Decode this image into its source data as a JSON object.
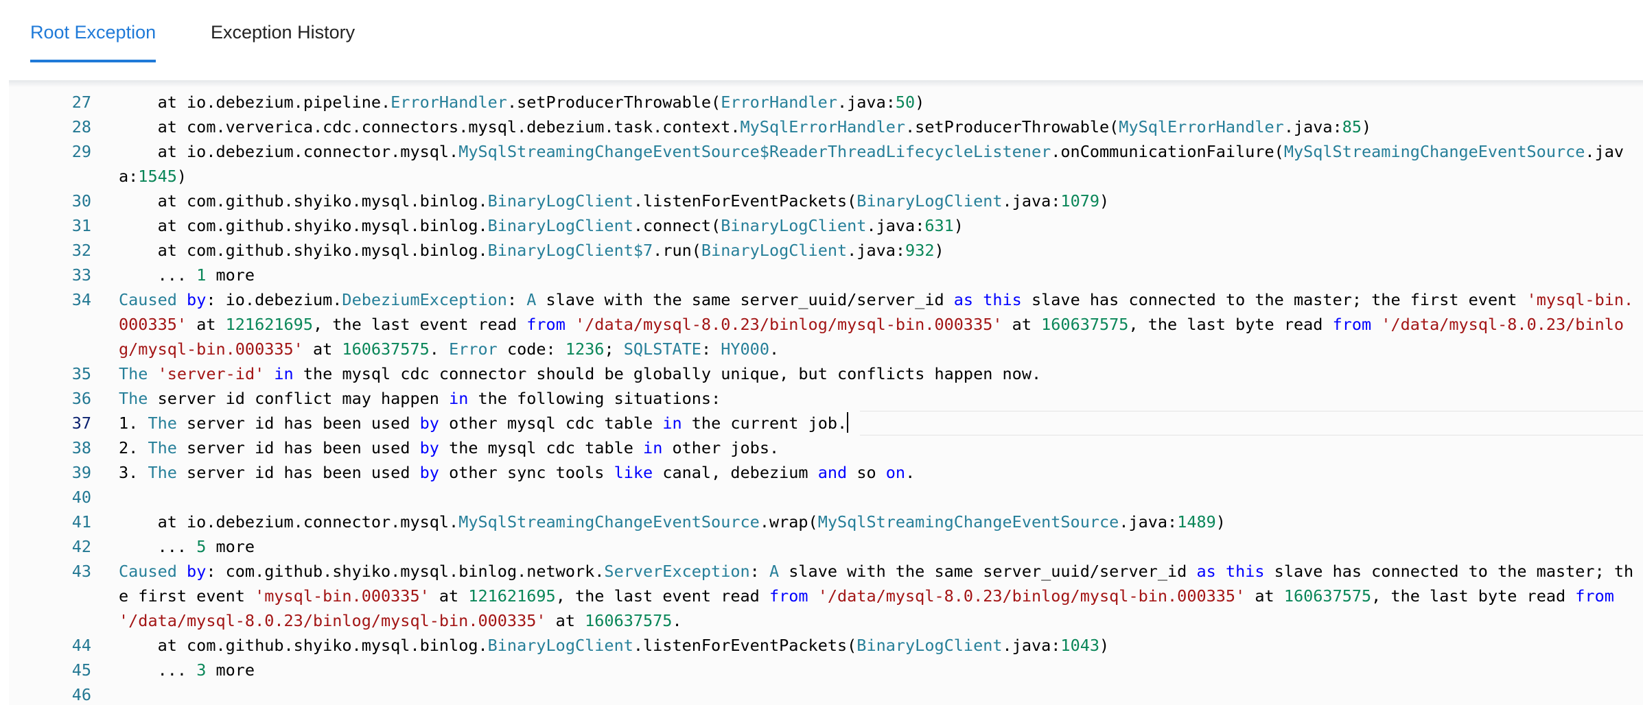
{
  "tabs": [
    {
      "label": "Root Exception",
      "active": true
    },
    {
      "label": "Exception History",
      "active": false
    }
  ],
  "editor": {
    "active_line": "37",
    "colors": {
      "default": "#000000",
      "type": "#267f99",
      "number": "#098658",
      "keyword": "#0000ff",
      "string": "#a31515",
      "line_number": "#237893",
      "active_tab": "#1f7ad8"
    },
    "lines": [
      {
        "n": "27",
        "tokens": [
          {
            "t": "    at io.debezium.pipeline.",
            "c": "default"
          },
          {
            "t": "ErrorHandler",
            "c": "type"
          },
          {
            "t": ".setProducerThrowable(",
            "c": "default"
          },
          {
            "t": "ErrorHandler",
            "c": "type"
          },
          {
            "t": ".java:",
            "c": "default"
          },
          {
            "t": "50",
            "c": "number"
          },
          {
            "t": ")",
            "c": "default"
          }
        ]
      },
      {
        "n": "28",
        "tokens": [
          {
            "t": "    at com.ververica.cdc.connectors.mysql.debezium.task.context.",
            "c": "default"
          },
          {
            "t": "MySqlErrorHandler",
            "c": "type"
          },
          {
            "t": ".setProducerThrowable(",
            "c": "default"
          },
          {
            "t": "MySqlErrorHandler",
            "c": "type"
          },
          {
            "t": ".java:",
            "c": "default"
          },
          {
            "t": "85",
            "c": "number"
          },
          {
            "t": ")",
            "c": "default"
          }
        ]
      },
      {
        "n": "29",
        "tokens": [
          {
            "t": "    at io.debezium.connector.mysql.",
            "c": "default"
          },
          {
            "t": "MySqlStreamingChangeEventSource$ReaderThreadLifecycleListener",
            "c": "type"
          },
          {
            "t": ".onCommunicationFailure(",
            "c": "default"
          },
          {
            "t": "MySqlStreamingChangeEventSource",
            "c": "type"
          },
          {
            "t": ".java:",
            "c": "default"
          },
          {
            "t": "1545",
            "c": "number"
          },
          {
            "t": ")",
            "c": "default"
          }
        ]
      },
      {
        "n": "30",
        "tokens": [
          {
            "t": "    at com.github.shyiko.mysql.binlog.",
            "c": "default"
          },
          {
            "t": "BinaryLogClient",
            "c": "type"
          },
          {
            "t": ".listenForEventPackets(",
            "c": "default"
          },
          {
            "t": "BinaryLogClient",
            "c": "type"
          },
          {
            "t": ".java:",
            "c": "default"
          },
          {
            "t": "1079",
            "c": "number"
          },
          {
            "t": ")",
            "c": "default"
          }
        ]
      },
      {
        "n": "31",
        "tokens": [
          {
            "t": "    at com.github.shyiko.mysql.binlog.",
            "c": "default"
          },
          {
            "t": "BinaryLogClient",
            "c": "type"
          },
          {
            "t": ".connect(",
            "c": "default"
          },
          {
            "t": "BinaryLogClient",
            "c": "type"
          },
          {
            "t": ".java:",
            "c": "default"
          },
          {
            "t": "631",
            "c": "number"
          },
          {
            "t": ")",
            "c": "default"
          }
        ]
      },
      {
        "n": "32",
        "tokens": [
          {
            "t": "    at com.github.shyiko.mysql.binlog.",
            "c": "default"
          },
          {
            "t": "BinaryLogClient$7",
            "c": "type"
          },
          {
            "t": ".run(",
            "c": "default"
          },
          {
            "t": "BinaryLogClient",
            "c": "type"
          },
          {
            "t": ".java:",
            "c": "default"
          },
          {
            "t": "932",
            "c": "number"
          },
          {
            "t": ")",
            "c": "default"
          }
        ]
      },
      {
        "n": "33",
        "tokens": [
          {
            "t": "    ... ",
            "c": "default"
          },
          {
            "t": "1",
            "c": "number"
          },
          {
            "t": " more",
            "c": "default"
          }
        ]
      },
      {
        "n": "34",
        "tokens": [
          {
            "t": "Caused",
            "c": "type"
          },
          {
            "t": " ",
            "c": "default"
          },
          {
            "t": "by",
            "c": "keyword"
          },
          {
            "t": ": io.debezium.",
            "c": "default"
          },
          {
            "t": "DebeziumException",
            "c": "type"
          },
          {
            "t": ": ",
            "c": "default"
          },
          {
            "t": "A",
            "c": "type"
          },
          {
            "t": " slave with the same server_uuid/server_id ",
            "c": "default"
          },
          {
            "t": "as",
            "c": "keyword"
          },
          {
            "t": " ",
            "c": "default"
          },
          {
            "t": "this",
            "c": "keyword"
          },
          {
            "t": " slave has connected to the master; the first event ",
            "c": "default"
          },
          {
            "t": "'mysql-bin.000335'",
            "c": "string"
          },
          {
            "t": " at ",
            "c": "default"
          },
          {
            "t": "121621695",
            "c": "number"
          },
          {
            "t": ", the last event read ",
            "c": "default"
          },
          {
            "t": "from",
            "c": "keyword"
          },
          {
            "t": " ",
            "c": "default"
          },
          {
            "t": "'/data/mysql-8.0.23/binlog/mysql-bin.000335'",
            "c": "string"
          },
          {
            "t": " at ",
            "c": "default"
          },
          {
            "t": "160637575",
            "c": "number"
          },
          {
            "t": ", the last byte read ",
            "c": "default"
          },
          {
            "t": "from",
            "c": "keyword"
          },
          {
            "t": " ",
            "c": "default"
          },
          {
            "t": "'/data/mysql-8.0.23/binlog/mysql-bin.000335'",
            "c": "string"
          },
          {
            "t": " at ",
            "c": "default"
          },
          {
            "t": "160637575",
            "c": "number"
          },
          {
            "t": ". ",
            "c": "default"
          },
          {
            "t": "Error",
            "c": "type"
          },
          {
            "t": " code: ",
            "c": "default"
          },
          {
            "t": "1236",
            "c": "number"
          },
          {
            "t": "; ",
            "c": "default"
          },
          {
            "t": "SQLSTATE",
            "c": "type"
          },
          {
            "t": ": ",
            "c": "default"
          },
          {
            "t": "HY000",
            "c": "type"
          },
          {
            "t": ".",
            "c": "default"
          }
        ]
      },
      {
        "n": "35",
        "tokens": [
          {
            "t": "The",
            "c": "type"
          },
          {
            "t": " ",
            "c": "default"
          },
          {
            "t": "'server-id'",
            "c": "string"
          },
          {
            "t": " ",
            "c": "default"
          },
          {
            "t": "in",
            "c": "keyword"
          },
          {
            "t": " the mysql cdc connector should be globally unique, but conflicts happen now.",
            "c": "default"
          }
        ]
      },
      {
        "n": "36",
        "tokens": [
          {
            "t": "The",
            "c": "type"
          },
          {
            "t": " server id conflict may happen ",
            "c": "default"
          },
          {
            "t": "in",
            "c": "keyword"
          },
          {
            "t": " the following situations:",
            "c": "default"
          }
        ]
      },
      {
        "n": "37",
        "cursor": true,
        "tokens": [
          {
            "t": "1. ",
            "c": "default"
          },
          {
            "t": "The",
            "c": "type"
          },
          {
            "t": " server id has been used ",
            "c": "default"
          },
          {
            "t": "by",
            "c": "keyword"
          },
          {
            "t": " other mysql cdc table ",
            "c": "default"
          },
          {
            "t": "in",
            "c": "keyword"
          },
          {
            "t": " the current job.",
            "c": "default"
          }
        ]
      },
      {
        "n": "38",
        "tokens": [
          {
            "t": "2. ",
            "c": "default"
          },
          {
            "t": "The",
            "c": "type"
          },
          {
            "t": " server id has been used ",
            "c": "default"
          },
          {
            "t": "by",
            "c": "keyword"
          },
          {
            "t": " the mysql cdc table ",
            "c": "default"
          },
          {
            "t": "in",
            "c": "keyword"
          },
          {
            "t": " other jobs.",
            "c": "default"
          }
        ]
      },
      {
        "n": "39",
        "tokens": [
          {
            "t": "3. ",
            "c": "default"
          },
          {
            "t": "The",
            "c": "type"
          },
          {
            "t": " server id has been used ",
            "c": "default"
          },
          {
            "t": "by",
            "c": "keyword"
          },
          {
            "t": " other sync tools ",
            "c": "default"
          },
          {
            "t": "like",
            "c": "keyword"
          },
          {
            "t": " canal, debezium ",
            "c": "default"
          },
          {
            "t": "and",
            "c": "keyword"
          },
          {
            "t": " so ",
            "c": "default"
          },
          {
            "t": "on",
            "c": "keyword"
          },
          {
            "t": ".",
            "c": "default"
          }
        ]
      },
      {
        "n": "40",
        "tokens": []
      },
      {
        "n": "41",
        "tokens": [
          {
            "t": "    at io.debezium.connector.mysql.",
            "c": "default"
          },
          {
            "t": "MySqlStreamingChangeEventSource",
            "c": "type"
          },
          {
            "t": ".wrap(",
            "c": "default"
          },
          {
            "t": "MySqlStreamingChangeEventSource",
            "c": "type"
          },
          {
            "t": ".java:",
            "c": "default"
          },
          {
            "t": "1489",
            "c": "number"
          },
          {
            "t": ")",
            "c": "default"
          }
        ]
      },
      {
        "n": "42",
        "tokens": [
          {
            "t": "    ... ",
            "c": "default"
          },
          {
            "t": "5",
            "c": "number"
          },
          {
            "t": " more",
            "c": "default"
          }
        ]
      },
      {
        "n": "43",
        "tokens": [
          {
            "t": "Caused",
            "c": "type"
          },
          {
            "t": " ",
            "c": "default"
          },
          {
            "t": "by",
            "c": "keyword"
          },
          {
            "t": ": com.github.shyiko.mysql.binlog.network.",
            "c": "default"
          },
          {
            "t": "ServerException",
            "c": "type"
          },
          {
            "t": ": ",
            "c": "default"
          },
          {
            "t": "A",
            "c": "type"
          },
          {
            "t": " slave with the same server_uuid/server_id ",
            "c": "default"
          },
          {
            "t": "as",
            "c": "keyword"
          },
          {
            "t": " ",
            "c": "default"
          },
          {
            "t": "this",
            "c": "keyword"
          },
          {
            "t": " slave has connected to the master; the first event ",
            "c": "default"
          },
          {
            "t": "'mysql-bin.000335'",
            "c": "string"
          },
          {
            "t": " at ",
            "c": "default"
          },
          {
            "t": "121621695",
            "c": "number"
          },
          {
            "t": ", the last event read ",
            "c": "default"
          },
          {
            "t": "from",
            "c": "keyword"
          },
          {
            "t": " ",
            "c": "default"
          },
          {
            "t": "'/data/mysql-8.0.23/binlog/mysql-bin.000335'",
            "c": "string"
          },
          {
            "t": " at ",
            "c": "default"
          },
          {
            "t": "160637575",
            "c": "number"
          },
          {
            "t": ", the last byte read ",
            "c": "default"
          },
          {
            "t": "from",
            "c": "keyword"
          },
          {
            "t": " ",
            "c": "default"
          },
          {
            "t": "'/data/mysql-8.0.23/binlog/mysql-bin.000335'",
            "c": "string"
          },
          {
            "t": " at ",
            "c": "default"
          },
          {
            "t": "160637575",
            "c": "number"
          },
          {
            "t": ".",
            "c": "default"
          }
        ]
      },
      {
        "n": "44",
        "tokens": [
          {
            "t": "    at com.github.shyiko.mysql.binlog.",
            "c": "default"
          },
          {
            "t": "BinaryLogClient",
            "c": "type"
          },
          {
            "t": ".listenForEventPackets(",
            "c": "default"
          },
          {
            "t": "BinaryLogClient",
            "c": "type"
          },
          {
            "t": ".java:",
            "c": "default"
          },
          {
            "t": "1043",
            "c": "number"
          },
          {
            "t": ")",
            "c": "default"
          }
        ]
      },
      {
        "n": "45",
        "tokens": [
          {
            "t": "    ... ",
            "c": "default"
          },
          {
            "t": "3",
            "c": "number"
          },
          {
            "t": " more",
            "c": "default"
          }
        ]
      },
      {
        "n": "46",
        "tokens": []
      }
    ]
  }
}
